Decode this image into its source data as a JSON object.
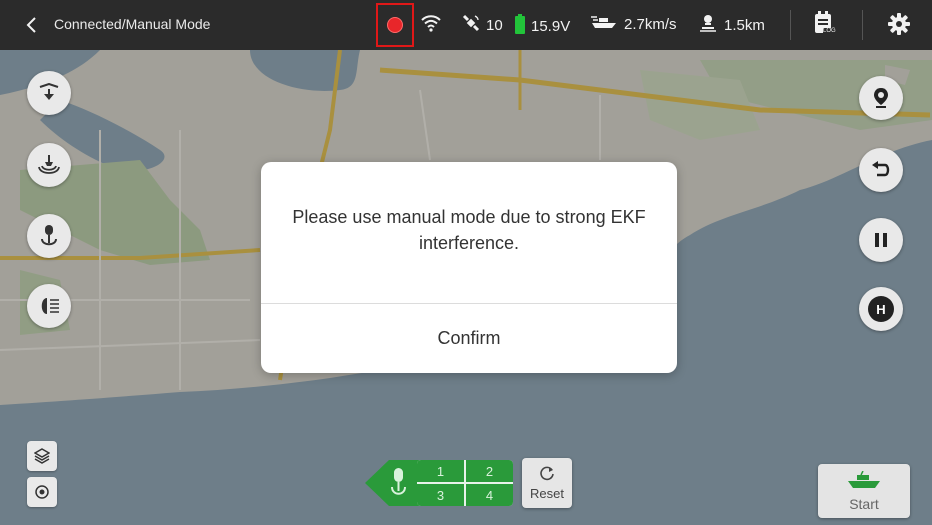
{
  "header": {
    "title": "Connected/Manual Mode",
    "satellites": "10",
    "voltage": "15.9V",
    "speed": "2.7km/s",
    "distance": "1.5km",
    "log_label": "LOG"
  },
  "icons": {
    "back": "chevron-left-icon",
    "record": "record-icon",
    "wifi": "wifi-icon",
    "satellite": "satellite-icon",
    "battery": "battery-icon",
    "boat_speed": "boat-speed-icon",
    "distance": "person-distance-icon",
    "log": "log-calendar-icon",
    "settings": "gear-icon"
  },
  "left_buttons": [
    "drop-down-icon",
    "sonar-icon",
    "bait-release-icon",
    "headlight-icon"
  ],
  "right_buttons": [
    "location-pin-icon",
    "return-icon",
    "pause-icon",
    "home-icon"
  ],
  "home_label": "H",
  "map_buttons": [
    "layers-icon",
    "locate-icon"
  ],
  "bait": {
    "cells": [
      "1",
      "2",
      "3",
      "4"
    ],
    "reset_label": "Reset"
  },
  "start_label": "Start",
  "dialog": {
    "message": "Please use manual mode due to strong EKF interference.",
    "confirm_label": "Confirm"
  },
  "colors": {
    "topbar": "#2b2b2b",
    "record": "#e8262a",
    "highlight_box": "#e01818",
    "battery": "#22c43a",
    "bait_green": "#2a9a3a"
  }
}
